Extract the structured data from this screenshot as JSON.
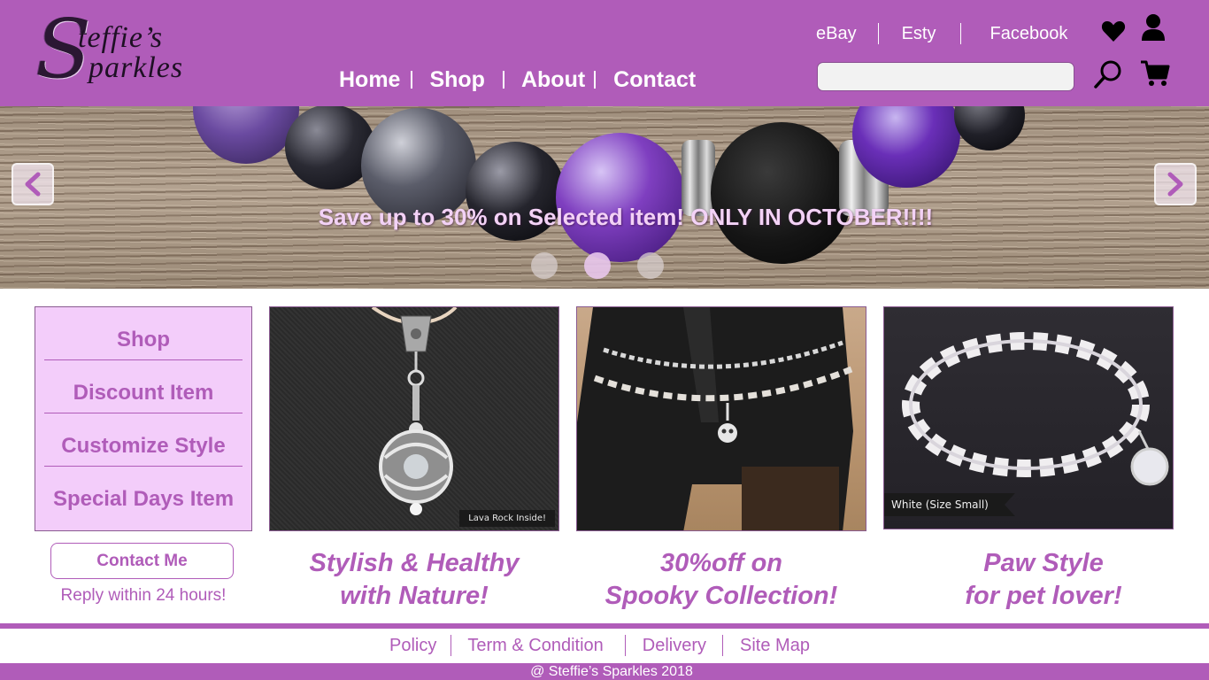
{
  "brand": {
    "logo_line1": "teffie’s",
    "logo_line2": "parkles",
    "logo_initial": "S"
  },
  "nav": {
    "items": [
      {
        "label": "Home"
      },
      {
        "label": "Shop"
      },
      {
        "label": "About"
      },
      {
        "label": "Contact"
      }
    ]
  },
  "external_links": [
    {
      "label": "eBay"
    },
    {
      "label": "Esty"
    },
    {
      "label": "Facebook"
    }
  ],
  "search": {
    "value": "",
    "placeholder": ""
  },
  "icons": {
    "wishlist": "heart-icon",
    "account": "user-icon",
    "search": "search-icon",
    "cart": "cart-icon",
    "prev": "chevron-left-icon",
    "next": "chevron-right-icon"
  },
  "hero": {
    "caption": "Save up to 30% on Selected item! ONLY IN OCTOBER!!!!",
    "slide_count": 3,
    "active_slide": 2
  },
  "sidebar": {
    "items": [
      {
        "label": "Shop"
      },
      {
        "label": "Discount Item"
      },
      {
        "label": "Customize Style"
      },
      {
        "label": "Special Days Item"
      }
    ]
  },
  "contact": {
    "button_label": "Contact Me",
    "reply_note": "Reply within 24 hours!"
  },
  "products": [
    {
      "caption_line1": "Stylish & Healthy",
      "caption_line2": "with Nature!",
      "image_tag": "Lava Rock Inside!"
    },
    {
      "caption_line1": "30%off on",
      "caption_line2": "Spooky Collection!",
      "image_tag": ""
    },
    {
      "caption_line1": "Paw Style",
      "caption_line2": "for pet lover!",
      "image_tag": "White (Size Small)"
    }
  ],
  "footer": {
    "links": [
      {
        "label": "Policy"
      },
      {
        "label": "Term & Condition"
      },
      {
        "label": "Delivery"
      },
      {
        "label": "Site Map"
      }
    ],
    "copyright": "@ Steffie’s Sparkles 2018"
  },
  "colors": {
    "brand_purple": "#b05cb9",
    "sidebar_bg": "#f3cdfa",
    "caption_pink": "#f3d2f6",
    "white": "#ffffff"
  }
}
